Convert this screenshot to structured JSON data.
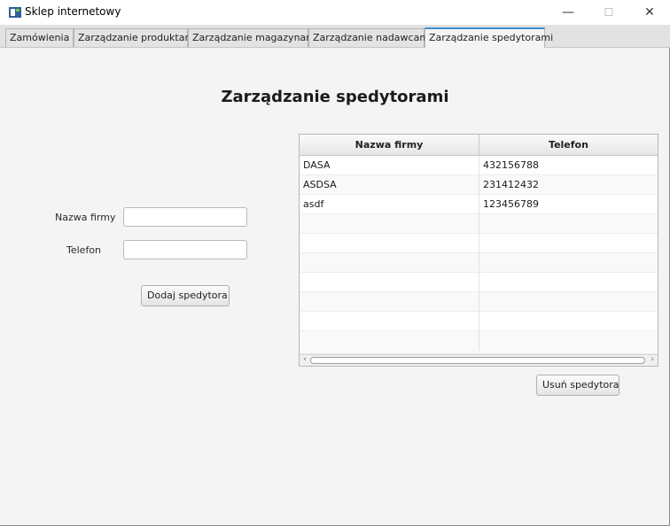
{
  "window": {
    "title": "Sklep internetowy",
    "controls": {
      "minimize": "—",
      "maximize": "☐",
      "close": "✕"
    }
  },
  "tabs": [
    {
      "label": "Zamówienia",
      "active": false
    },
    {
      "label": "Zarządzanie produktami",
      "active": false
    },
    {
      "label": "Zarządzanie magazynami",
      "active": false
    },
    {
      "label": "Zarządzanie nadawcami",
      "active": false
    },
    {
      "label": "Zarządzanie spedytorami",
      "active": true
    }
  ],
  "page": {
    "title": "Zarządzanie spedytorami"
  },
  "form": {
    "company_label": "Nazwa firmy",
    "company_value": "",
    "phone_label": "Telefon",
    "phone_value": "",
    "add_button": "Dodaj spedytora"
  },
  "table": {
    "columns": [
      "Nazwa firmy",
      "Telefon"
    ],
    "rows": [
      [
        "DASA",
        "432156788"
      ],
      [
        "ASDSA",
        "231412432"
      ],
      [
        "asdf",
        "123456789"
      ]
    ]
  },
  "delete_button": "Usuń spedytora",
  "colors": {
    "accent": "#3c8fd6",
    "background": "#f4f4f4"
  }
}
